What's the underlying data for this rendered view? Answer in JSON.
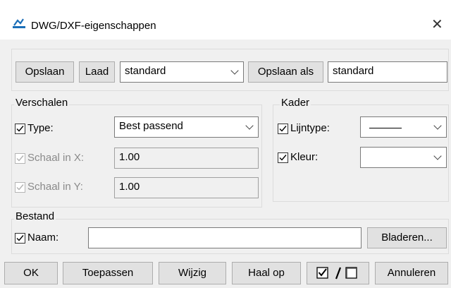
{
  "window": {
    "title": "DWG/DXF-eigenschappen",
    "app_icon": "dwg-app-icon",
    "close_icon": "close-icon"
  },
  "toolbar": {
    "save_label": "Opslaan",
    "load_label": "Laad",
    "preset_selected": "standard",
    "save_as_label": "Opslaan als",
    "save_as_value": "standard"
  },
  "scale": {
    "title": "Verschalen",
    "type_label": "Type:",
    "type_checked": true,
    "type_selected": "Best passend",
    "scale_x_label": "Schaal in X:",
    "scale_x_value": "1.00",
    "scale_y_label": "Schaal in Y:",
    "scale_y_value": "1.00"
  },
  "frame": {
    "title": "Kader",
    "linetype_label": "Lijntype:",
    "linetype_checked": true,
    "color_label": "Kleur:",
    "color_checked": true,
    "color_selected": ""
  },
  "file": {
    "title": "Bestand",
    "name_label": "Naam:",
    "name_checked": true,
    "name_value": "",
    "browse_label": "Bladeren..."
  },
  "footer": {
    "ok_label": "OK",
    "apply_label": "Toepassen",
    "change_label": "Wijzig",
    "retrieve_label": "Haal op",
    "toggle_icon": "check-toggle-icon",
    "cancel_label": "Annuleren"
  }
}
